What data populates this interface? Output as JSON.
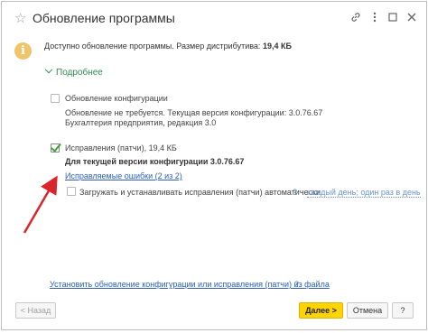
{
  "window": {
    "title": "Обновление программы",
    "icons": {
      "favorite": "star-icon",
      "link": "link-icon",
      "more": "more-icon",
      "maximize": "maximize-icon",
      "close": "close-icon"
    }
  },
  "info": {
    "icon": "info-icon",
    "text": "Доступно обновление программы. Размер дистрибутива: ",
    "size": "19,4 КБ"
  },
  "details_toggle": "Подробнее",
  "config_update": {
    "checked": false,
    "label": "Обновление конфигурации",
    "note": "Обновление не требуется. Текущая версия конфигурации: 3.0.76.67",
    "product": "Бухгалтерия предприятия, редакция 3.0"
  },
  "patches": {
    "checked": true,
    "label": "Исправления (патчи), 19,4 КБ",
    "for_version": "Для текущей версии конфигурации 3.0.76.67",
    "errors_link": "Исправляемые ошибки (2 из 2)",
    "auto_checked": false,
    "auto_label": "Загружать и устанавливать исправления (патчи) автоматически",
    "help": "?",
    "schedule_link": "каждый день; один раз в день"
  },
  "install_from_file_link": "Установить обновление конфигурации или исправления (патчи) из файла",
  "help": "?",
  "buttons": {
    "back": "< Назад",
    "next": "Далее >",
    "cancel": "Отмена",
    "help": "?"
  },
  "annotation_color": "#d9262b",
  "accent_color": "#ffd400"
}
